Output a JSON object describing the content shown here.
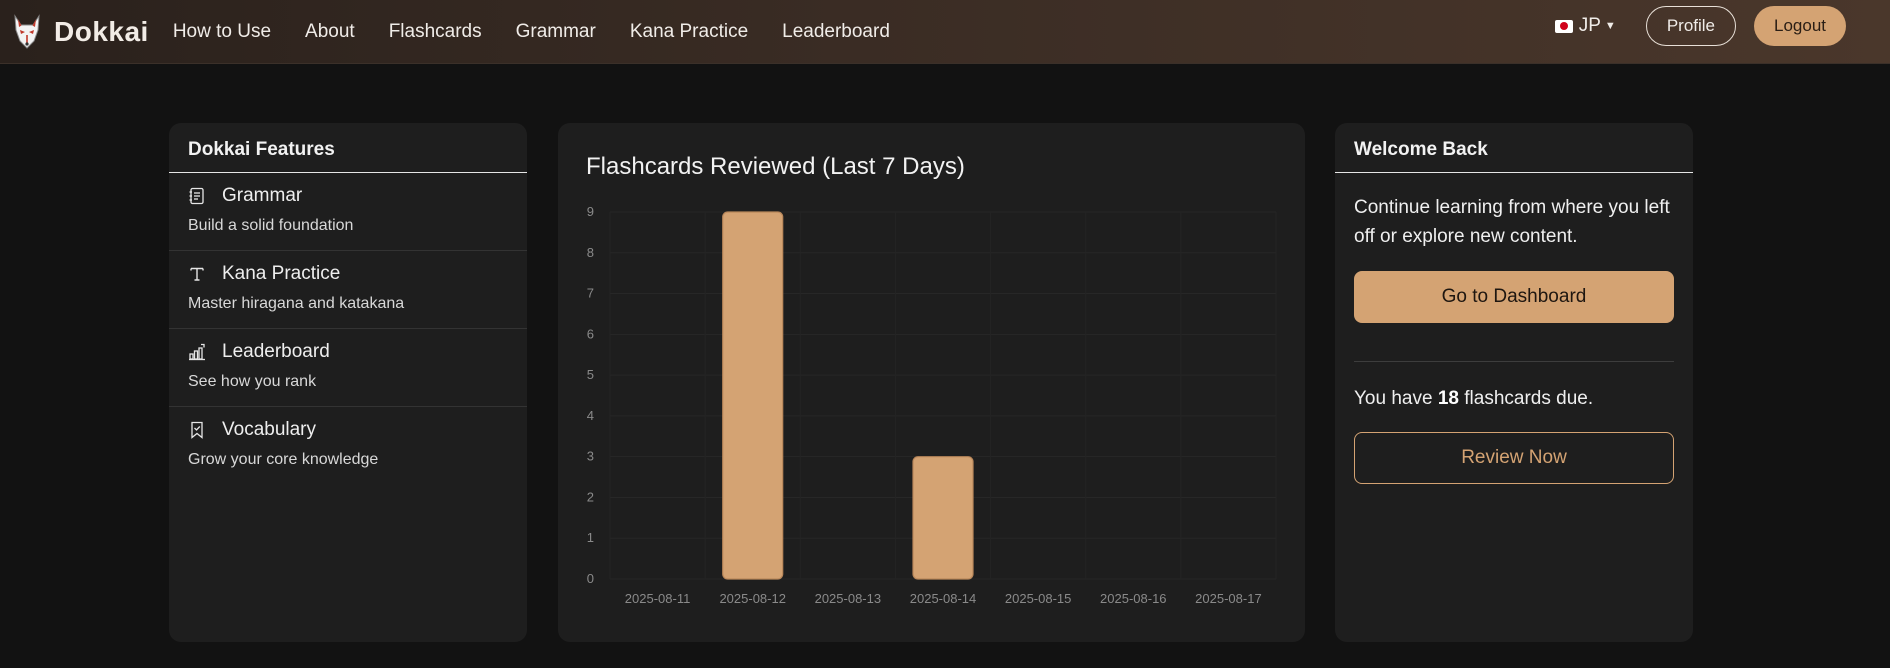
{
  "brand": {
    "name": "Dokkai",
    "logo_icon": "fox-mask-icon"
  },
  "nav": {
    "links": [
      "How to Use",
      "About",
      "Flashcards",
      "Grammar",
      "Kana Practice",
      "Leaderboard"
    ],
    "language": "JP",
    "profile_label": "Profile",
    "logout_label": "Logout"
  },
  "features": {
    "title": "Dokkai Features",
    "items": [
      {
        "icon": "notebook-icon",
        "title": "Grammar",
        "desc": "Build a solid foundation"
      },
      {
        "icon": "text-t-icon",
        "title": "Kana Practice",
        "desc": "Master hiragana and katakana"
      },
      {
        "icon": "bar-chart-icon",
        "title": "Leaderboard",
        "desc": "See how you rank"
      },
      {
        "icon": "bookmark-icon",
        "title": "Vocabulary",
        "desc": "Grow your core knowledge"
      }
    ]
  },
  "chart": {
    "title": "Flashcards Reviewed (Last 7 Days)"
  },
  "chart_data": {
    "type": "bar",
    "categories": [
      "2025-08-11",
      "2025-08-12",
      "2025-08-13",
      "2025-08-14",
      "2025-08-15",
      "2025-08-16",
      "2025-08-17"
    ],
    "values": [
      0,
      9,
      0,
      3,
      0,
      0,
      0
    ],
    "ylim": [
      0,
      9
    ],
    "yticks": [
      0,
      1,
      2,
      3,
      4,
      5,
      6,
      7,
      8,
      9
    ],
    "grid": true,
    "legend": "none",
    "bar_color": "#d4a373"
  },
  "welcome": {
    "title": "Welcome Back",
    "text": "Continue learning from where you left off or explore new content.",
    "dashboard_label": "Go to Dashboard",
    "due_prefix": "You have ",
    "due_count": "18",
    "due_suffix": " flashcards due.",
    "review_label": "Review Now"
  },
  "colors": {
    "accent": "#d4a373",
    "background": "#121212",
    "card": "#1e1e1e"
  }
}
